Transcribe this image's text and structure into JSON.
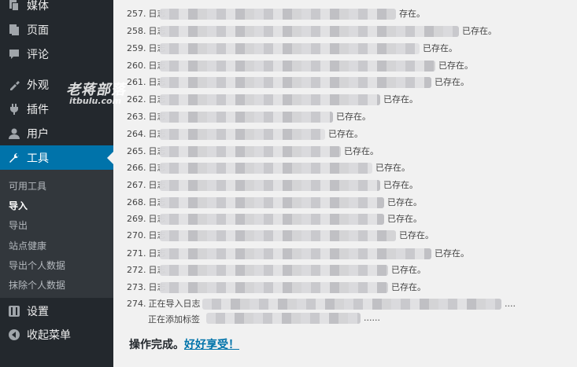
{
  "sidebar": {
    "items": [
      {
        "label": "媒体",
        "icon": "media-icon"
      },
      {
        "label": "页面",
        "icon": "page-icon"
      },
      {
        "label": "评论",
        "icon": "comment-icon"
      },
      {
        "label": "外观",
        "icon": "appearance-icon"
      },
      {
        "label": "插件",
        "icon": "plugin-icon"
      },
      {
        "label": "用户",
        "icon": "user-icon"
      },
      {
        "label": "工具",
        "icon": "wrench-icon"
      },
      {
        "label": "设置",
        "icon": "settings-icon"
      },
      {
        "label": "收起菜单",
        "icon": "collapse-icon"
      }
    ],
    "submenu": [
      "可用工具",
      "导入",
      "导出",
      "站点健康",
      "导出个人数据",
      "抹除个人数据"
    ],
    "accent": "#0073aa"
  },
  "watermark": {
    "title": "老蒋部落",
    "subtitle": "itbulu.com"
  },
  "log": [
    {
      "num": "257.",
      "prefix": "日志",
      "suffix": "存在。"
    },
    {
      "num": "258.",
      "prefix": "日志",
      "suffix": "已存在。"
    },
    {
      "num": "259.",
      "prefix": "日志",
      "suffix": "已存在。"
    },
    {
      "num": "260.",
      "prefix": "日志",
      "suffix": "已存在。"
    },
    {
      "num": "261.",
      "prefix": "日志",
      "suffix": "已存在。"
    },
    {
      "num": "262.",
      "prefix": "日志",
      "suffix": "已存在。"
    },
    {
      "num": "263.",
      "prefix": "日志",
      "suffix": "已存在。"
    },
    {
      "num": "264.",
      "prefix": "日志",
      "suffix": "已存在。"
    },
    {
      "num": "265.",
      "prefix": "日志",
      "suffix": "已存在。"
    },
    {
      "num": "266.",
      "prefix": "日志",
      "suffix": "已存在。"
    },
    {
      "num": "267.",
      "prefix": "日志",
      "suffix": "已存在。"
    },
    {
      "num": "268.",
      "prefix": "日志",
      "suffix": "已存在。"
    },
    {
      "num": "269.",
      "prefix": "日志",
      "suffix": "已存在。"
    },
    {
      "num": "270.",
      "prefix": "日志",
      "suffix": "已存在。"
    },
    {
      "num": "271.",
      "prefix": "日志",
      "suffix": "已存在。"
    },
    {
      "num": "272.",
      "prefix": "日志",
      "suffix": "已存在。"
    },
    {
      "num": "273.",
      "prefix": "日志",
      "suffix": "已存在。"
    },
    {
      "num": "274.",
      "prefix": "正在导入日志",
      "suffix": "...."
    }
  ],
  "tag_line": {
    "text": "正在添加标签",
    "suffix": "......"
  },
  "done": {
    "text": "操作完成。",
    "link": "好好享受！"
  }
}
